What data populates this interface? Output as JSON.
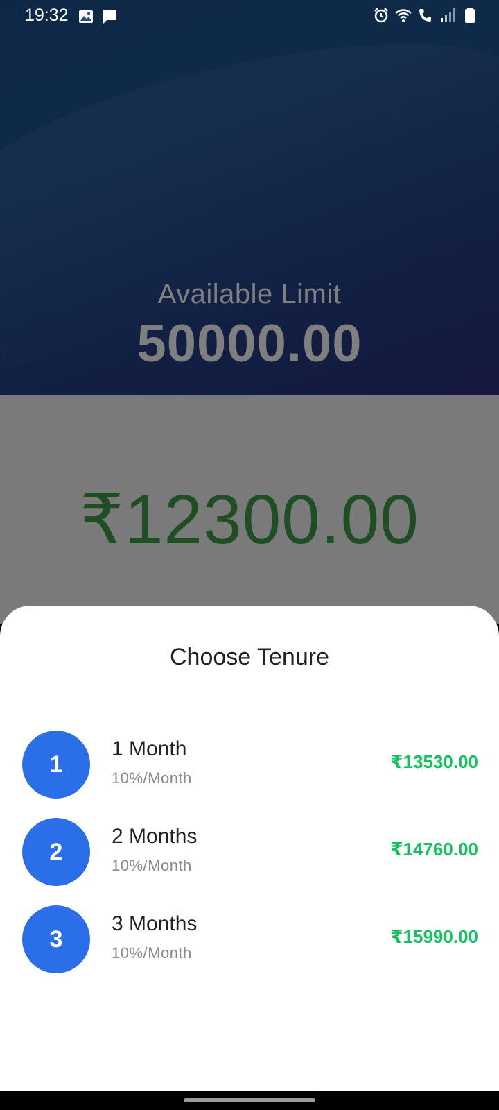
{
  "status_bar": {
    "time": "19:32",
    "left_icons": [
      "image-icon",
      "message-icon"
    ],
    "right_icons": [
      "alarm-icon",
      "wifi-icon",
      "wifi-calling-icon",
      "signal-icon",
      "battery-icon"
    ]
  },
  "hero": {
    "label": "Available Limit",
    "value": "50000.00"
  },
  "amount": {
    "value": "₹12300.00"
  },
  "sheet": {
    "title": "Choose Tenure",
    "options": [
      {
        "number": "1",
        "name": "1 Month",
        "rate": "10%/Month",
        "amount": "₹13530.00"
      },
      {
        "number": "2",
        "name": "2 Months",
        "rate": "10%/Month",
        "amount": "₹14760.00"
      },
      {
        "number": "3",
        "name": "3 Months",
        "rate": "10%/Month",
        "amount": "₹15990.00"
      }
    ]
  },
  "colors": {
    "accent_blue": "#2b6fe8",
    "amount_green": "#13c25e",
    "hero_blue": "#1f5592"
  }
}
